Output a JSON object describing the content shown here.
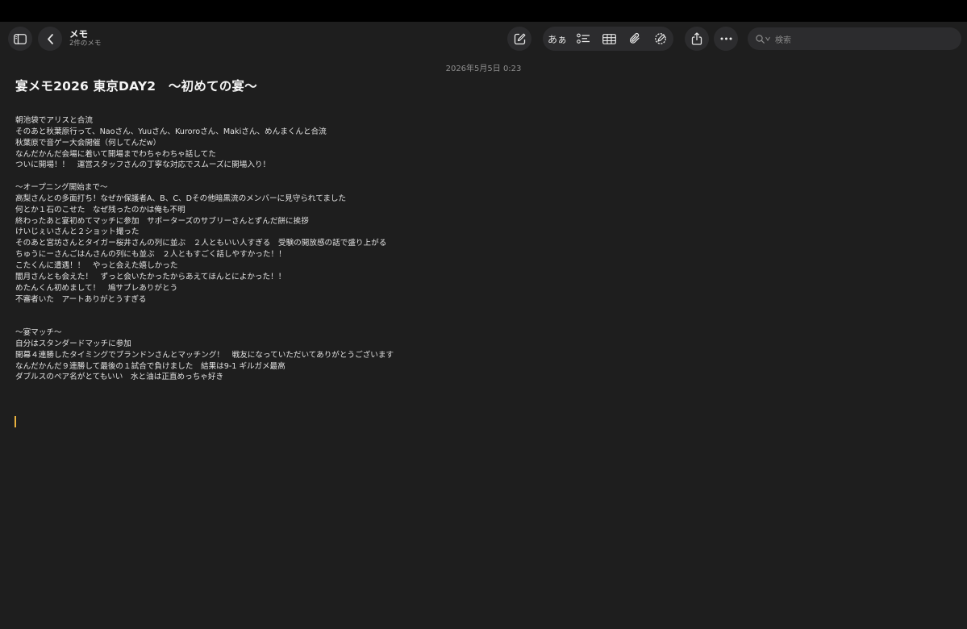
{
  "window": {
    "title": "メモ",
    "subtitle": "2件のメモ"
  },
  "toolbar": {
    "format_label": "あぁ",
    "search_placeholder": "検索",
    "icons": [
      "sidebar-icon",
      "back-chevron-icon",
      "compose-icon",
      "checklist-icon",
      "table-icon",
      "paperclip-icon",
      "markup-icon",
      "share-icon",
      "more-icon",
      "search-icon",
      "mic-icon"
    ]
  },
  "note": {
    "timestamp": "2026年5月5日 0:23",
    "title": "宴メモ2026 東京DAY2　〜初めての宴〜",
    "lines": [
      "朝池袋でアリスと合流",
      "そのあと秋葉原行って、Naoさん、Yuuさん、Kuroroさん、Makiさん、めんまくんと合流",
      "秋葉原で音ゲー大会開催（何してんだw）",
      "なんだかんだ会場に着いて開場までわちゃわちゃ話してた",
      "ついに開場！！　運営スタッフさんの丁寧な対応でスムーズに開場入り！",
      "",
      "〜オープニング開始まで〜",
      "高梨さんとの多面打ち！なぜか保護者A、B、C、Dその他暗黒流のメンバーに見守られてました",
      "何とか１石のこせた　なぜ残ったのかは俺も不明",
      "終わったあと宴初めてマッチに参加　サポーターズのサブリーさんとずんだ餅に挨拶",
      "けいじぇいさんと２ショット撮った",
      "そのあと宮坊さんとタイガー桜井さんの列に並ぶ　２人ともいい人すぎる　受験の開放感の話で盛り上がる",
      "ちゅうにーさんごはんさんの列にも並ぶ　２人ともすごく話しやすかった！！",
      "こたくんに遭遇！！　やっと会えた嬉しかった",
      "闇月さんとも会えた！　ずっと会いたかったからあえてほんとによかった！！",
      "めたんくん初めまして！　鳩サブレありがとう",
      "不審者いた　アートありがとうすぎる",
      "",
      "",
      "〜宴マッチ〜",
      "自分はスタンダードマッチに参加",
      "開幕４連勝したタイミングでブランドンさんとマッチング！　戦友になっていただいてありがとうございます",
      "なんだかんだ９連勝して最後の１試合で負けました　結果は9-1 ギルガメ最高",
      "ダブルスのペア名がとてもいい　水と油は正直めっちゃ好き"
    ]
  },
  "colors": {
    "background": "#1e1e1e",
    "button_bg": "#2c2c2e",
    "caret": "#e8b13f"
  }
}
